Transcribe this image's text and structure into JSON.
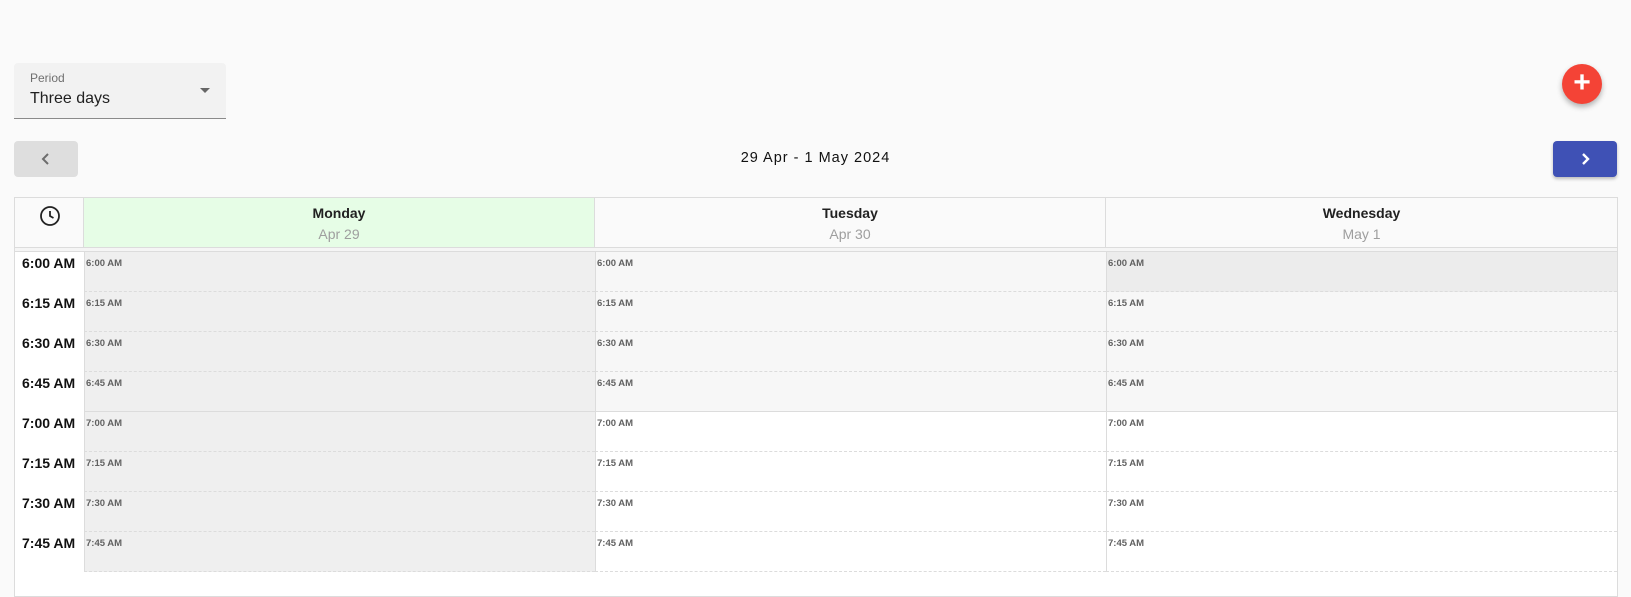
{
  "period": {
    "label": "Period",
    "value": "Three days"
  },
  "fab": {
    "icon": "plus-icon",
    "symbol": "+"
  },
  "nav": {
    "prev_icon": "chevron-left-icon",
    "next_icon": "chevron-right-icon",
    "range": "29 Apr - 1 May 2024"
  },
  "days": [
    {
      "name": "Monday",
      "date": "Apr 29"
    },
    {
      "name": "Tuesday",
      "date": "Apr 30"
    },
    {
      "name": "Wednesday",
      "date": "May 1"
    }
  ],
  "times": [
    "6:00 AM",
    "6:15 AM",
    "6:30 AM",
    "6:45 AM",
    "7:00 AM",
    "7:15 AM",
    "7:30 AM",
    "7:45 AM"
  ],
  "colors": {
    "today_header": "#e6fde6",
    "past_slot": "#efefef",
    "accent": "#3f51b5",
    "fab": "#f44336"
  }
}
